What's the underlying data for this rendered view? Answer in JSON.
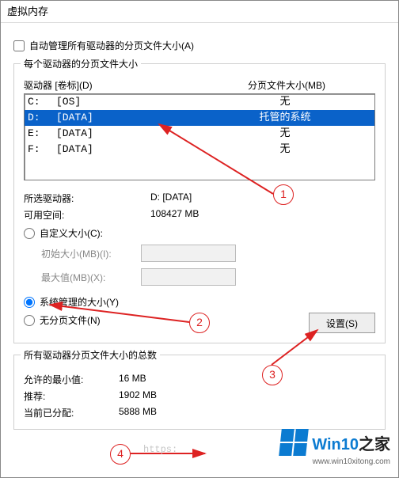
{
  "title": "虚拟内存",
  "checkbox_auto": "自动管理所有驱动器的分页文件大小(A)",
  "group_drives_label": "每个驱动器的分页文件大小",
  "hdr_drive": "驱动器 [卷标](D)",
  "hdr_paging": "分页文件大小(MB)",
  "rows": [
    {
      "drv": "C:",
      "lbl": "[OS]",
      "pf": "无",
      "sel": false
    },
    {
      "drv": "D:",
      "lbl": "[DATA]",
      "pf": "托管的系统",
      "sel": true
    },
    {
      "drv": "E:",
      "lbl": "[DATA]",
      "pf": "无",
      "sel": false
    },
    {
      "drv": "F:",
      "lbl": "[DATA]",
      "pf": "无",
      "sel": false
    }
  ],
  "selected_drive_k": "所选驱动器:",
  "selected_drive_v": "D:  [DATA]",
  "avail_space_k": "可用空间:",
  "avail_space_v": "108427 MB",
  "radio_custom": "自定义大小(C):",
  "initial_label": "初始大小(MB)(I):",
  "max_label": "最大值(MB)(X):",
  "radio_system": "系统管理的大小(Y)",
  "radio_none": "无分页文件(N)",
  "set_button": "设置(S)",
  "group_totals_label": "所有驱动器分页文件大小的总数",
  "min_k": "允许的最小值:",
  "min_v": "16 MB",
  "rec_k": "推荐:",
  "rec_v": "1902 MB",
  "cur_k": "当前已分配:",
  "cur_v": "5888 MB",
  "anno": {
    "n1": "1",
    "n2": "2",
    "n3": "3",
    "n4": "4"
  },
  "watermark_brand": "Win10",
  "watermark_brand2": "之家",
  "watermark_url": "www.win10xitong.com",
  "faint_url": "https:"
}
